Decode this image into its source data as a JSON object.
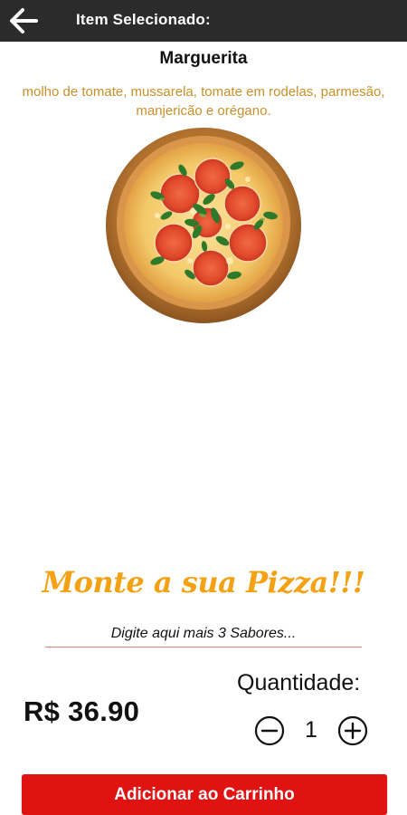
{
  "header": {
    "title": "Item Selecionado:",
    "back_icon": "arrow-left-icon"
  },
  "product": {
    "name": "Marguerita",
    "description": "molho de tomate, mussarela, tomate em rodelas, parmesão, manjericão e orégano.",
    "price": "R$ 36.90"
  },
  "promo": {
    "slogan": "Monte a sua Pizza!!!"
  },
  "flavors": {
    "placeholder": "Digite aqui mais 3 Sabores...",
    "value": ""
  },
  "quantity": {
    "label": "Quantidade:",
    "value": "1",
    "minus_icon": "minus-circle-icon",
    "plus_icon": "plus-circle-icon"
  },
  "actions": {
    "add_to_cart_label": "Adicionar ao Carrinho"
  },
  "colors": {
    "header_bg": "#2b2b2b",
    "description": "#c8902a",
    "slogan": "#f4a214",
    "button_bg": "#e01212"
  }
}
